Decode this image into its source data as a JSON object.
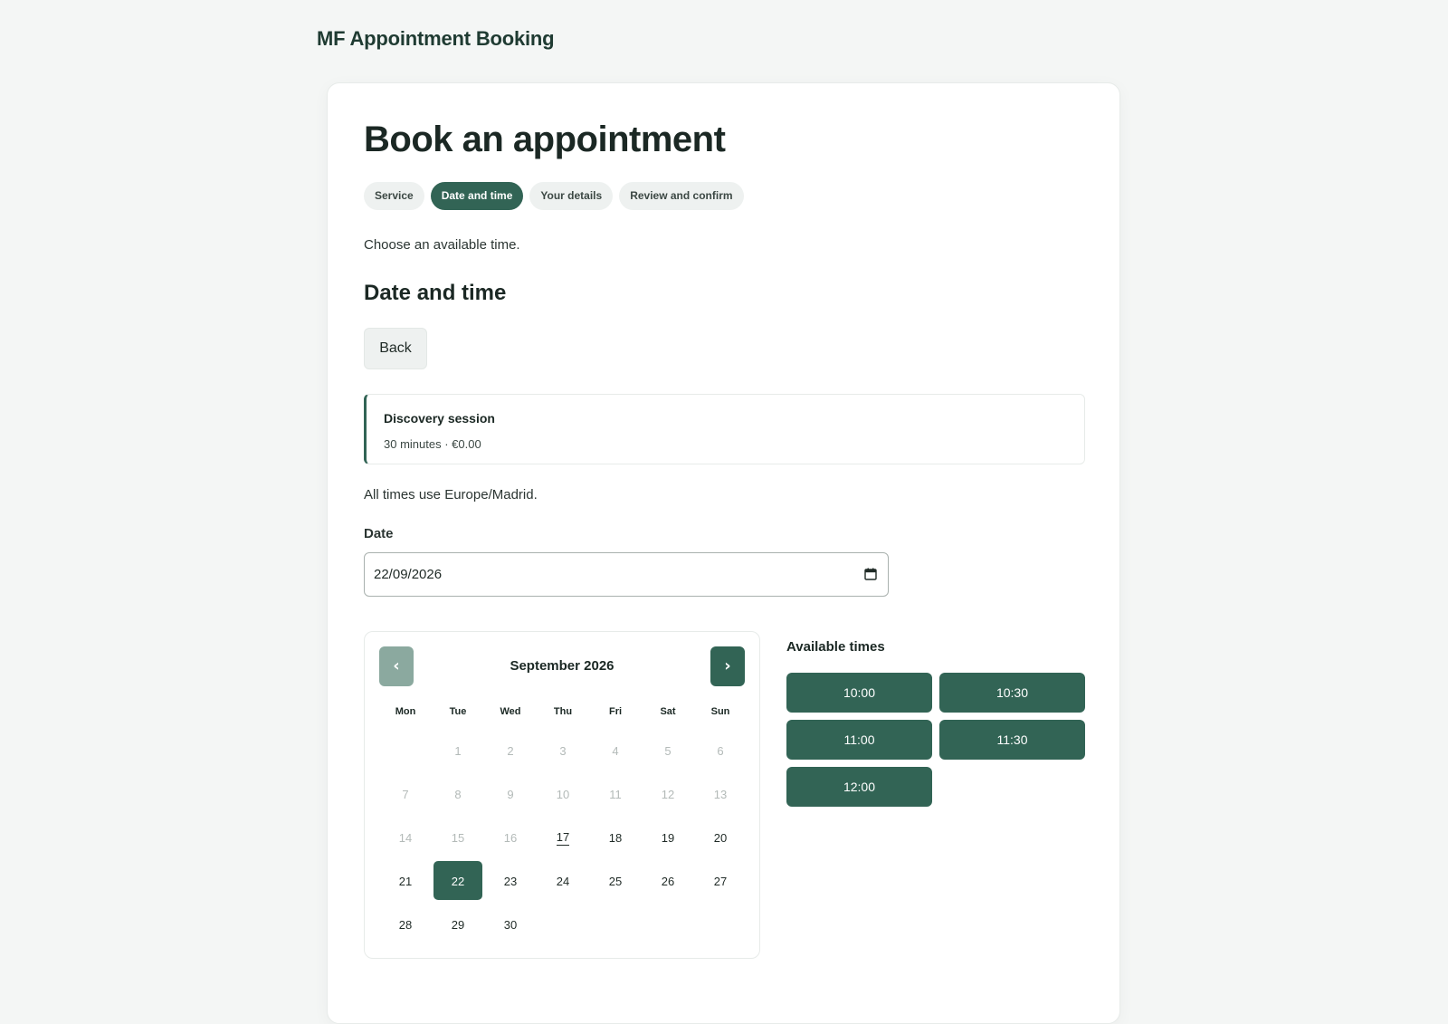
{
  "brand": "MF Appointment Booking",
  "page_title": "Book an appointment",
  "steps": [
    {
      "label": "Service",
      "active": false
    },
    {
      "label": "Date and time",
      "active": true
    },
    {
      "label": "Your details",
      "active": false
    },
    {
      "label": "Review and confirm",
      "active": false
    }
  ],
  "intro": "Choose an available time.",
  "section_title": "Date and time",
  "back_label": "Back",
  "service": {
    "name": "Discovery session",
    "meta": "30 minutes · €0.00"
  },
  "timezone_note": "All times use Europe/Madrid.",
  "date_field": {
    "label": "Date",
    "value": "22/09/2026",
    "icon": "calendar-icon"
  },
  "calendar": {
    "month_label": "September 2026",
    "prev_label": "‹",
    "next_label": "›",
    "weekdays": [
      "Mon",
      "Tue",
      "Wed",
      "Thu",
      "Fri",
      "Sat",
      "Sun"
    ],
    "leading_blanks": 1,
    "days": [
      {
        "label": "1",
        "state": "disabled"
      },
      {
        "label": "2",
        "state": "disabled"
      },
      {
        "label": "3",
        "state": "disabled"
      },
      {
        "label": "4",
        "state": "disabled"
      },
      {
        "label": "5",
        "state": "disabled"
      },
      {
        "label": "6",
        "state": "disabled"
      },
      {
        "label": "7",
        "state": "disabled"
      },
      {
        "label": "8",
        "state": "disabled"
      },
      {
        "label": "9",
        "state": "disabled"
      },
      {
        "label": "10",
        "state": "disabled"
      },
      {
        "label": "11",
        "state": "disabled"
      },
      {
        "label": "12",
        "state": "disabled"
      },
      {
        "label": "13",
        "state": "disabled"
      },
      {
        "label": "14",
        "state": "disabled"
      },
      {
        "label": "15",
        "state": "disabled"
      },
      {
        "label": "16",
        "state": "disabled"
      },
      {
        "label": "17",
        "state": "today"
      },
      {
        "label": "18",
        "state": "available"
      },
      {
        "label": "19",
        "state": "available"
      },
      {
        "label": "20",
        "state": "available"
      },
      {
        "label": "21",
        "state": "available"
      },
      {
        "label": "22",
        "state": "selected"
      },
      {
        "label": "23",
        "state": "available"
      },
      {
        "label": "24",
        "state": "available"
      },
      {
        "label": "25",
        "state": "available"
      },
      {
        "label": "26",
        "state": "available"
      },
      {
        "label": "27",
        "state": "available"
      },
      {
        "label": "28",
        "state": "available"
      },
      {
        "label": "29",
        "state": "available"
      },
      {
        "label": "30",
        "state": "available"
      }
    ]
  },
  "times": {
    "title": "Available times",
    "slots": [
      "10:00",
      "10:30",
      "11:00",
      "11:30",
      "12:00"
    ]
  },
  "colors": {
    "accent": "#326455",
    "accent_muted": "#8ba99f",
    "background": "#f4f6f5"
  }
}
